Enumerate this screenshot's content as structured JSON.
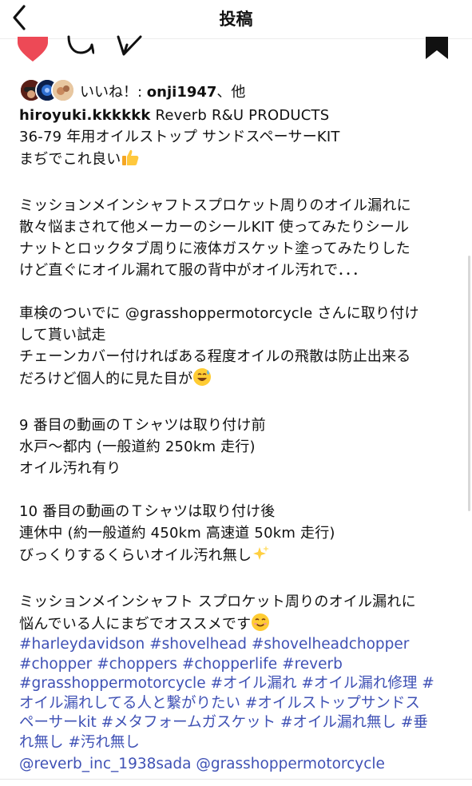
{
  "header": {
    "title": "投稿"
  },
  "icons": {
    "back": "back-chevron-icon",
    "like": "heart-icon",
    "comment": "comment-bubble-icon",
    "share": "paper-plane-icon",
    "save": "bookmark-icon"
  },
  "colors": {
    "like": "#ed4956",
    "hashtag": "#3f51b5"
  },
  "likes": {
    "prefix": "いいね！: ",
    "user": "onji1947",
    "suffix": "、他"
  },
  "caption": {
    "username": "hiroyuki.kkkkkk",
    "line1_rest": " Reverb R&U PRODUCTS",
    "line2": "36-79 年用オイルストップ サンドスペーサーKIT",
    "line3": "まぢでこれ良い",
    "p1_l1": "ミッションメインシャフトスプロケット周りのオイル漏れに",
    "p1_l2": "散々悩まされて他メーカーのシールKIT 使ってみたりシール",
    "p1_l3": "ナットとロックタブ周りに液体ガスケット塗ってみたりした",
    "p1_l4": "けど直ぐにオイル漏れて服の背中がオイル汚れで．．．",
    "p2_l1": "車検のついでに @grasshoppermotorcycle さんに取り付け",
    "p2_l2": "して貰い試走",
    "p2_l3": "チェーンカバー付ければある程度オイルの飛散は防止出来る",
    "p2_l4": "だろけど個人的に見た目が",
    "p3_l1": "9 番目の動画のＴシャツは取り付け前",
    "p3_l2": "水戸〜都内 (一般道約 250km 走行)",
    "p3_l3": "オイル汚れ有り",
    "p4_l1": "10 番目の動画のＴシャツは取り付け後",
    "p4_l2": "連休中 (約一般道約 450km 高速道 50km 走行)",
    "p4_l3": "びっくりするくらいオイル汚れ無し",
    "p5_l1": "ミッションメインシャフト スプロケット周りのオイル漏れに",
    "p5_l2": "悩んでいる人にまぢでオススメです"
  },
  "hashtags": {
    "l1": [
      "#harleydavidson",
      "#shovelhead",
      "#shovelheadchopper"
    ],
    "l2": [
      "#chopper",
      "#choppers",
      "#chopperlife",
      "#reverb"
    ],
    "l3": [
      "#grasshoppermotorcycle",
      "#オイル漏れ",
      "#オイル漏れ修理",
      "#"
    ],
    "l4": [
      "オイル漏れしてる人と繋がりたい",
      "#オイルストップサンドス"
    ],
    "l5": [
      "ペーサーkit",
      "#メタフォームガスケット",
      "#オイル漏れ無し",
      "#垂"
    ],
    "l6": [
      "れ無し",
      "#汚れ無し"
    ]
  },
  "mentions": [
    "@reverb_inc_1938sada",
    "@grasshoppermotorcycle"
  ]
}
